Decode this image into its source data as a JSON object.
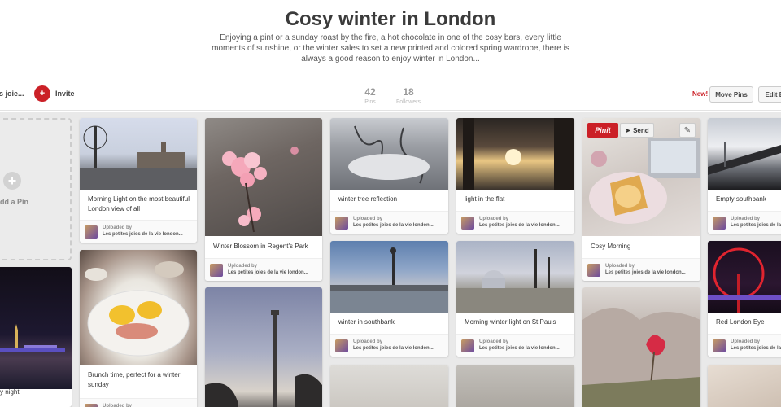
{
  "board": {
    "title": "Cosy winter in London",
    "description": "Enjoying a pint or a sunday roast by the fire, a hot chocolate in one of the cosy bars, every little moments of sunshine, or the winter sales to set a new printed and colored spring wardrobe, there is always a good reason to enjoy winter in London...",
    "owner_label": "es joie...",
    "invite_label": "Invite",
    "stats": [
      {
        "value": "42",
        "label": "Pins"
      },
      {
        "value": "18",
        "label": "Followers"
      }
    ],
    "new_label": "New!",
    "move_pins_label": "Move Pins",
    "edit_board_label": "Edit B"
  },
  "add_pin": {
    "label": "dd a Pin",
    "icon": "plus-icon"
  },
  "pin_common": {
    "uploaded_by": "Uploaded by",
    "uploader": "Les petites joies de la vie london..."
  },
  "pin_actions": {
    "pinit": "Pinit",
    "send": "Send"
  },
  "pins": [
    {
      "desc": "Morning Light on the most beautiful London view of all"
    },
    {
      "desc": "Brunch time, perfect for a winter sunday"
    },
    {
      "desc": "Winter Blossom in Regent's Park"
    },
    {
      "desc": "winter tree reflection"
    },
    {
      "desc": "winter in southbank"
    },
    {
      "desc": "light in the flat"
    },
    {
      "desc": "Morning winter light on St Pauls"
    },
    {
      "desc": "Cosy Morning"
    },
    {
      "desc": "Empty southbank"
    },
    {
      "desc": "Red London Eye"
    },
    {
      "desc": "y night"
    }
  ],
  "colors": {
    "brand_red": "#cb2027",
    "grid_bg": "#e9e9e9"
  }
}
